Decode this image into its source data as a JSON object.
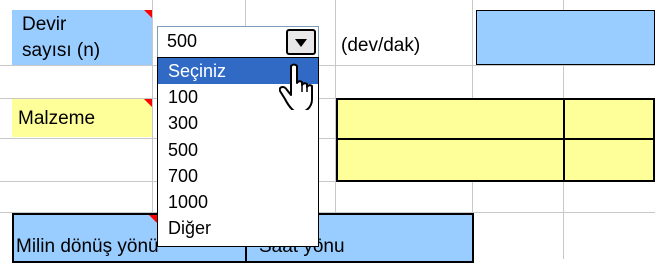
{
  "sheet": {
    "devir_label_line1": "Devir",
    "devir_label_line2": "sayısı (n)",
    "unit_label": "(dev/dak)",
    "malzeme_label": "Malzeme",
    "milin_label": "Milin dönüş yönü",
    "saat_label": "Saat yönu"
  },
  "combo": {
    "selected_value": "500",
    "options": [
      "Seçiniz",
      "100",
      "300",
      "500",
      "700",
      "1000",
      "Diğer"
    ],
    "highlighted_index": 0
  },
  "colors": {
    "label_blue": "#99ccff",
    "label_yellow": "#ffff99",
    "highlight": "#316ac5",
    "comment_marker": "#ff0000"
  },
  "icons": [
    "dropdown-arrow-icon",
    "hand-cursor-icon",
    "comment-indicator-icon"
  ]
}
